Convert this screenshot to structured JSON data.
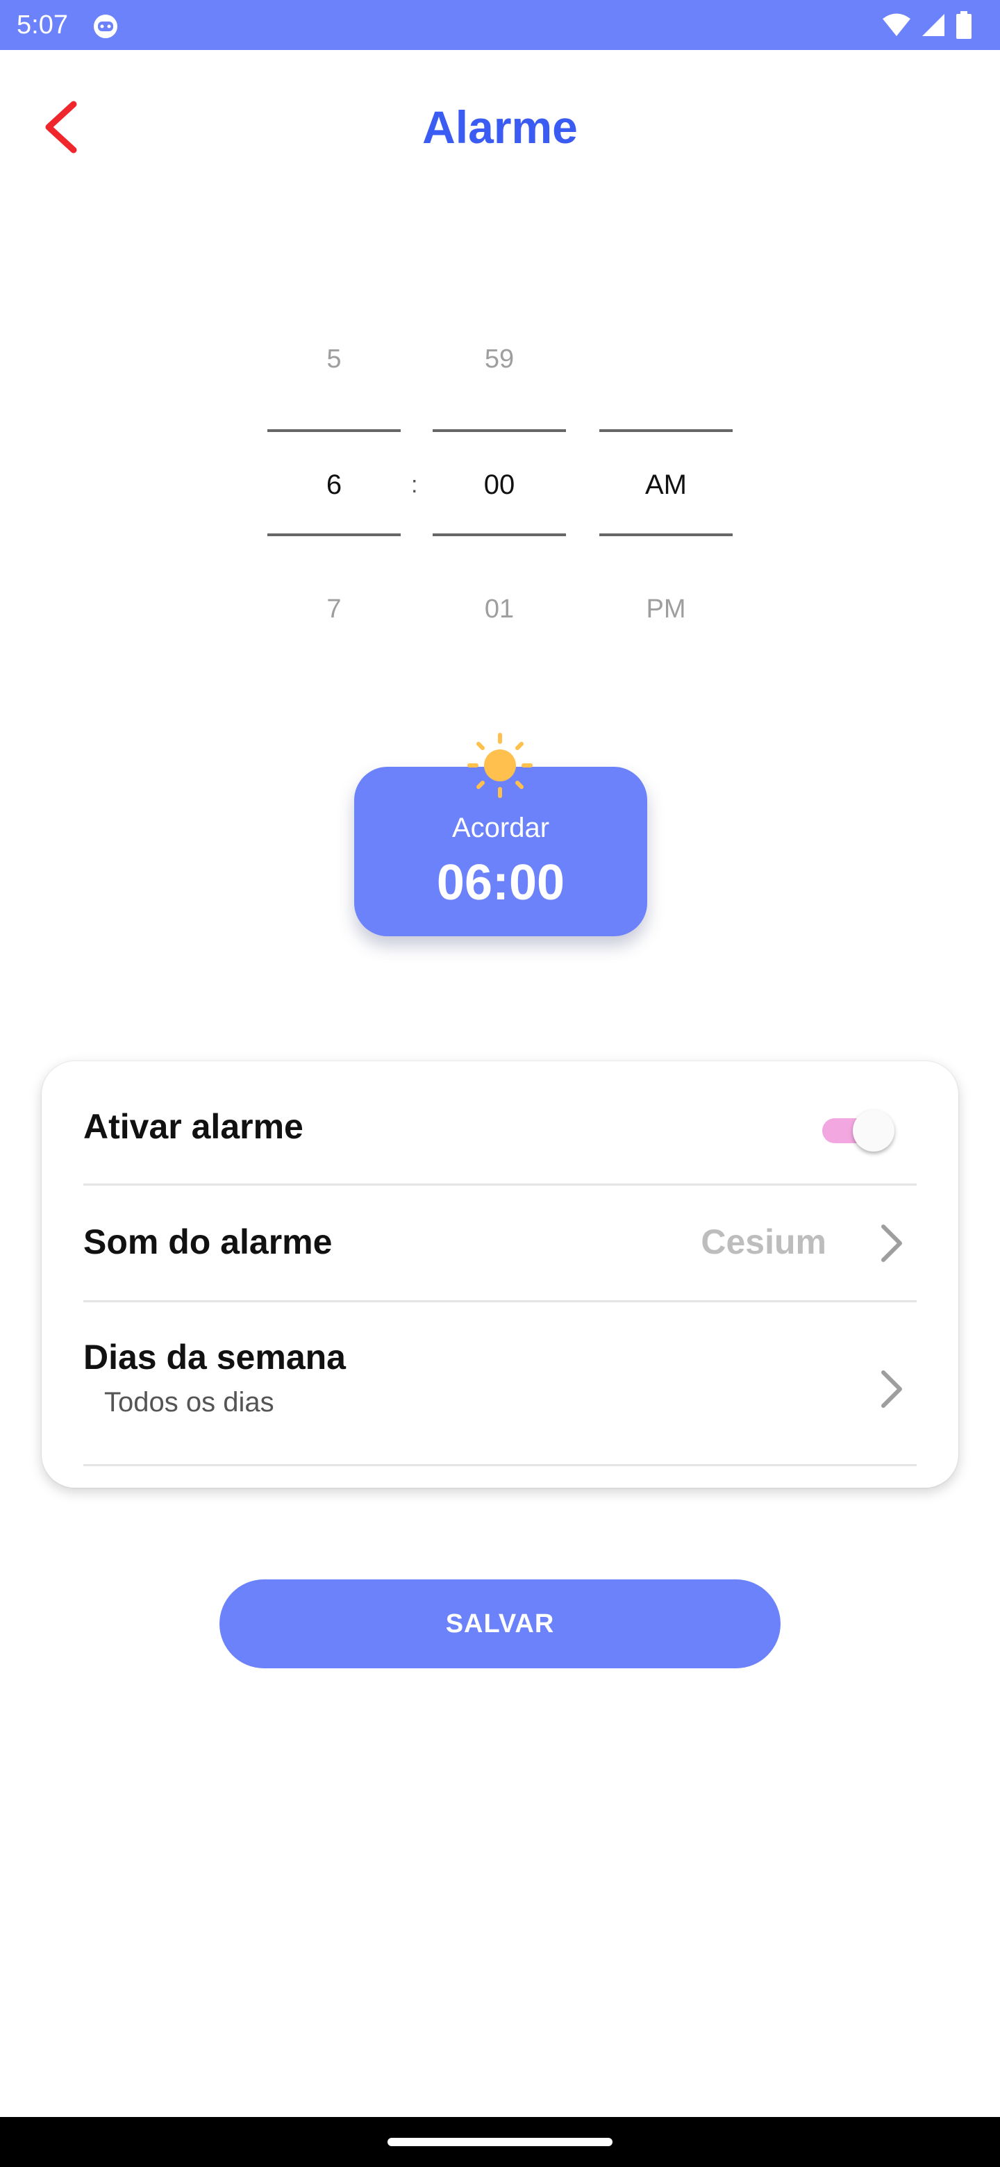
{
  "status_bar": {
    "time": "5:07",
    "icons": [
      "robot-icon",
      "wifi-icon",
      "signal-icon",
      "battery-icon"
    ]
  },
  "header": {
    "title": "Alarme",
    "back_icon": "chevron-left-icon",
    "title_color": "#3b5cf2",
    "back_color": "#f0262d"
  },
  "time_picker": {
    "separator": ":",
    "hours": {
      "prev": "5",
      "selected": "6",
      "next": "7"
    },
    "minutes": {
      "prev": "59",
      "selected": "00",
      "next": "01"
    },
    "period": {
      "prev": "",
      "selected": "AM",
      "next": "PM"
    }
  },
  "wake_card": {
    "label": "Acordar",
    "time": "06:00",
    "icon": "sun-icon",
    "color": "#6b82fb"
  },
  "settings": {
    "enable_alarm": {
      "label": "Ativar alarme",
      "enabled": true
    },
    "alarm_sound": {
      "label": "Som do alarme",
      "value": "Cesium"
    },
    "weekdays": {
      "label": "Dias da semana",
      "value": "Todos os dias"
    }
  },
  "save_button": {
    "label": "SALVAR"
  },
  "colors": {
    "accent": "#6b82fb",
    "toggle_track": "#f3a7e0"
  }
}
